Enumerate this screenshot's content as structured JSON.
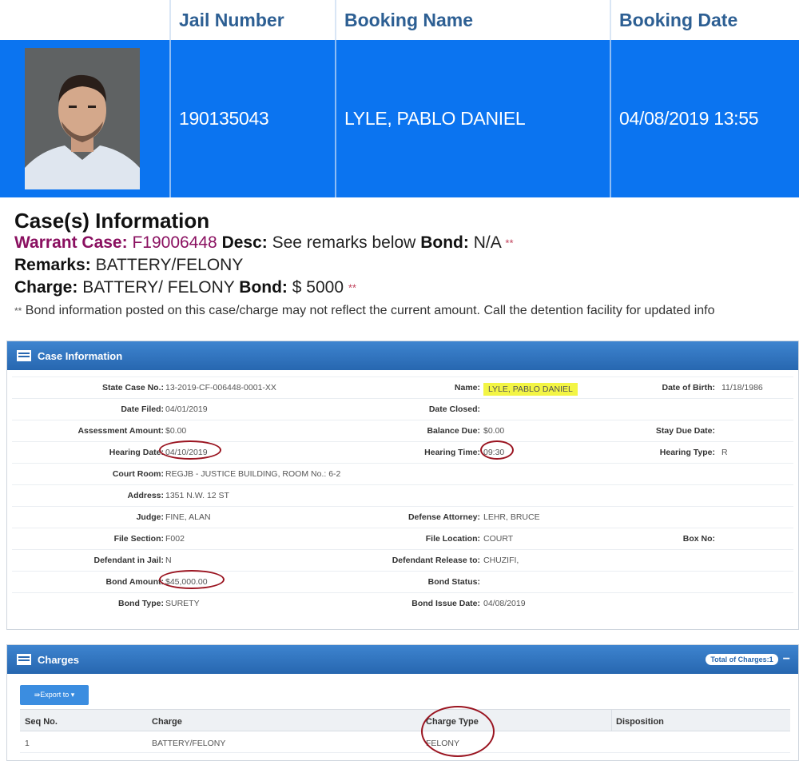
{
  "booking": {
    "headers": [
      "Jail Number",
      "Booking Name",
      "Booking Date"
    ],
    "jail_number": "190135043",
    "booking_name": "LYLE, PABLO DANIEL",
    "booking_date": "04/08/2019 13:55"
  },
  "cases": {
    "title": "Case(s) Information",
    "warrant_label": "Warrant Case:",
    "warrant_value": "F19006448",
    "desc_label": "Desc:",
    "desc_value": "See remarks below",
    "bond_label": "Bond:",
    "bond_value": "N/A",
    "stars": "**",
    "remarks_label": "Remarks:",
    "remarks_value": "BATTERY/FELONY",
    "charge_label": "Charge:",
    "charge_value": "BATTERY/ FELONY",
    "charge_bond_label": "Bond:",
    "charge_bond_value": "$ 5000",
    "note": "Bond information posted on this case/charge may not reflect the current amount. Call the detention facility for updated info"
  },
  "case_info": {
    "title": "Case Information",
    "rows": [
      {
        "l1": "State Case No.:",
        "v1": "13-2019-CF-006448-0001-XX",
        "l2": "Name:",
        "v2": "LYLE, PABLO DANIEL",
        "l3": "Date of Birth:",
        "v3": "11/18/1986"
      },
      {
        "l1": "Date Filed:",
        "v1": "04/01/2019",
        "l2": "Date Closed:",
        "v2": "",
        "l3": "",
        "v3": ""
      },
      {
        "l1": "Assessment Amount:",
        "v1": "$0.00",
        "l2": "Balance Due:",
        "v2": "$0.00",
        "l3": "Stay Due Date:",
        "v3": ""
      },
      {
        "l1": "Hearing Date:",
        "v1": "04/10/2019",
        "l2": "Hearing Time:",
        "v2": "09:30",
        "l3": "Hearing Type:",
        "v3": "R"
      },
      {
        "l1": "Court Room:",
        "v1": "REGJB - JUSTICE BUILDING, ROOM No.: 6-2",
        "l2": "",
        "v2": "",
        "l3": "",
        "v3": ""
      },
      {
        "l1": "Address:",
        "v1": "1351 N.W. 12 ST",
        "l2": "",
        "v2": "",
        "l3": "",
        "v3": ""
      },
      {
        "l1": "Judge:",
        "v1": "FINE, ALAN",
        "l2": "Defense Attorney:",
        "v2": "LEHR, BRUCE",
        "l3": "",
        "v3": ""
      },
      {
        "l1": "File Section:",
        "v1": "F002",
        "l2": "File Location:",
        "v2": "COURT",
        "l3": "Box No:",
        "v3": ""
      },
      {
        "l1": "Defendant in Jail:",
        "v1": "N",
        "l2": "Defendant Release to:",
        "v2": "CHUZIFI,",
        "l3": "",
        "v3": ""
      },
      {
        "l1": "Bond Amount:",
        "v1": "$45,000.00",
        "l2": "Bond Status:",
        "v2": "",
        "l3": "",
        "v3": ""
      },
      {
        "l1": "Bond Type:",
        "v1": "SURETY",
        "l2": "Bond Issue Date:",
        "v2": "04/08/2019",
        "l3": "",
        "v3": ""
      }
    ]
  },
  "charges": {
    "title": "Charges",
    "total_badge": "Total of Charges:1",
    "collapse": "−",
    "export_label": "⇛Export to ▾",
    "columns": [
      "Seq No.",
      "Charge",
      "Charge Type",
      "Disposition"
    ],
    "rows": [
      {
        "seq": "1",
        "charge": "BATTERY/FELONY",
        "type": "FELONY",
        "disposition": ""
      }
    ]
  },
  "colors": {
    "row_blue": "#0b74f0",
    "header_text": "#2d5f93",
    "panel_blue": "#2767b0",
    "highlight": "#f3f545",
    "annotation_red": "#9a1420"
  }
}
